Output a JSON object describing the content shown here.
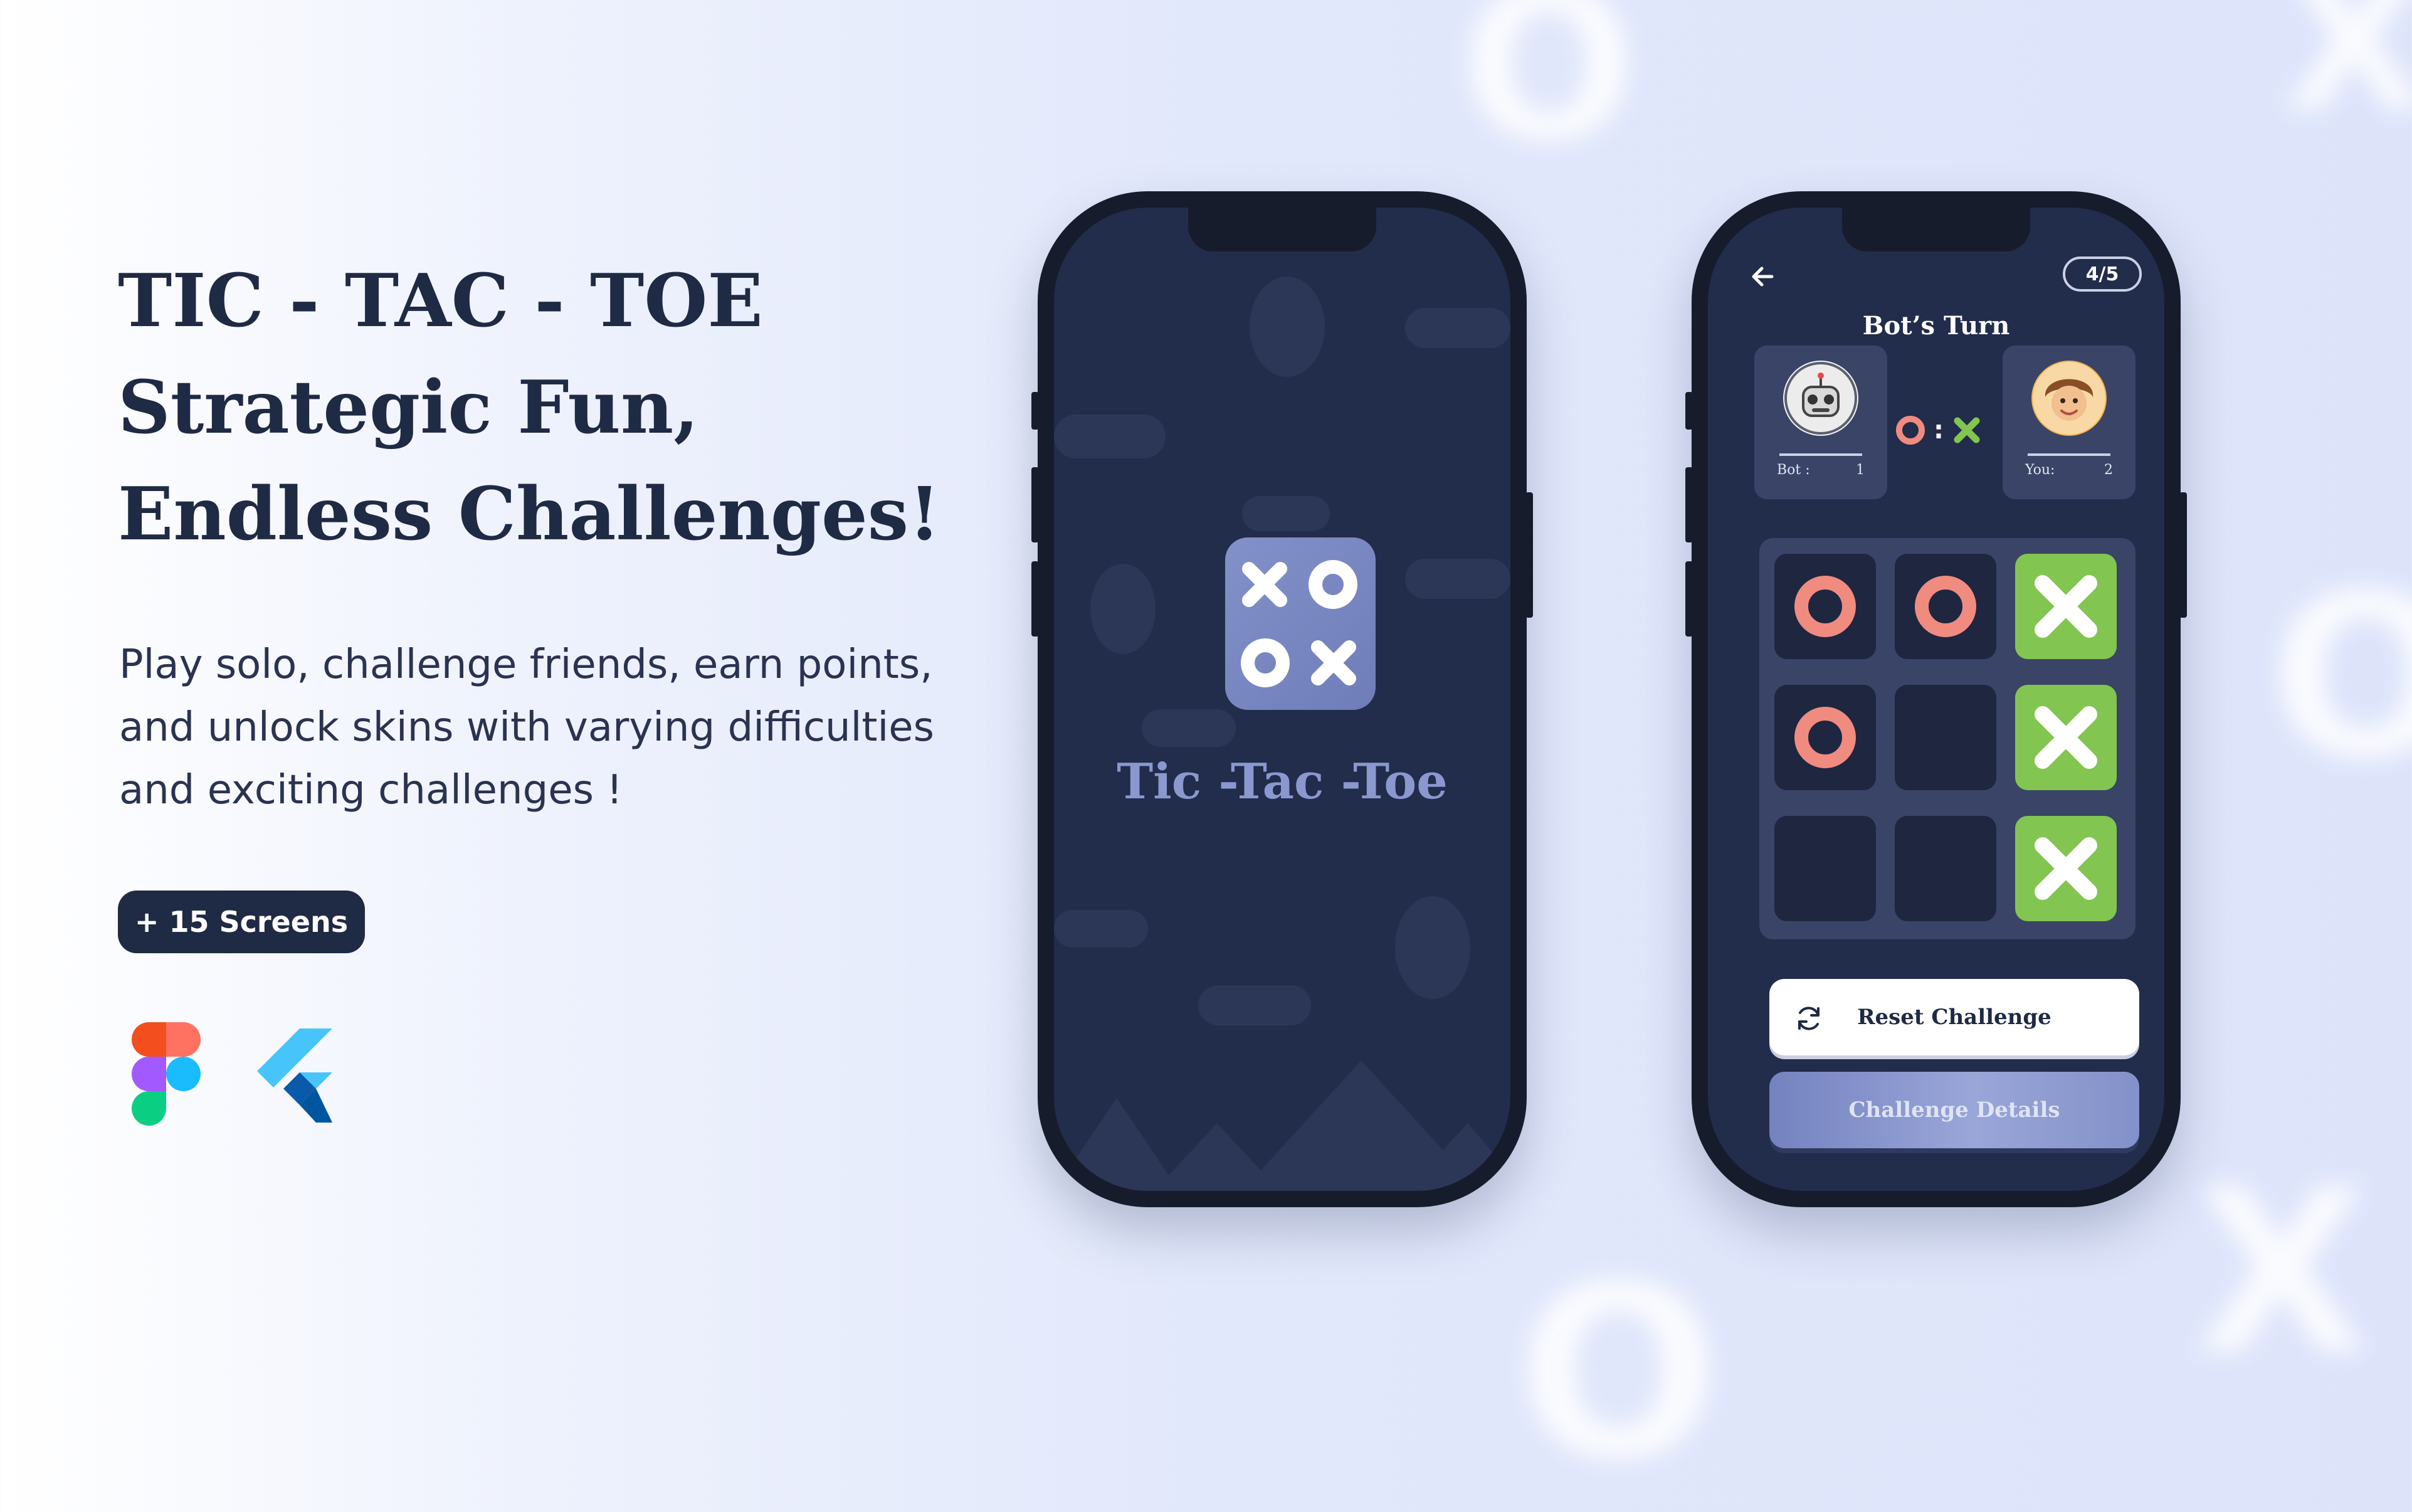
{
  "marketing": {
    "headline": [
      "TIC - TAC - TOE",
      "Strategic Fun,",
      "Endless Challenges!"
    ],
    "description": "Play solo, challenge friends, earn points, and unlock skins with varying difficulties and exciting challenges !",
    "screens_badge": "+ 15 Screens",
    "tool_icons": [
      "figma-logo",
      "flutter-logo"
    ],
    "background_marks": [
      "O",
      "X",
      "O",
      "X",
      "O"
    ]
  },
  "splash_screen": {
    "title": "Tic -Tac -Toe",
    "app_icon": "tic-tac-toe-app-icon"
  },
  "game_screen": {
    "round": "4/5",
    "turn_title": "Bot’s Turn",
    "bot": {
      "label": "Bot :",
      "score": "1",
      "avatar": "robot-avatar"
    },
    "you": {
      "label": "You:",
      "score": "2",
      "avatar": "user-avatar"
    },
    "versus_separator": ":",
    "board": [
      [
        "O",
        "O",
        "X"
      ],
      [
        "O",
        "",
        "X"
      ],
      [
        "",
        "",
        "X"
      ]
    ],
    "winning_cells": [
      [
        0,
        2
      ],
      [
        1,
        2
      ],
      [
        2,
        2
      ]
    ],
    "reset_button": "Reset Challenge",
    "details_button": "Challenge Details"
  },
  "colors": {
    "navy": "#1f2a44",
    "screen_bg": "#222c4b",
    "o_mark": "#f08b7f",
    "x_win_cell": "#82c550",
    "accent_purple": "#8391c9"
  }
}
